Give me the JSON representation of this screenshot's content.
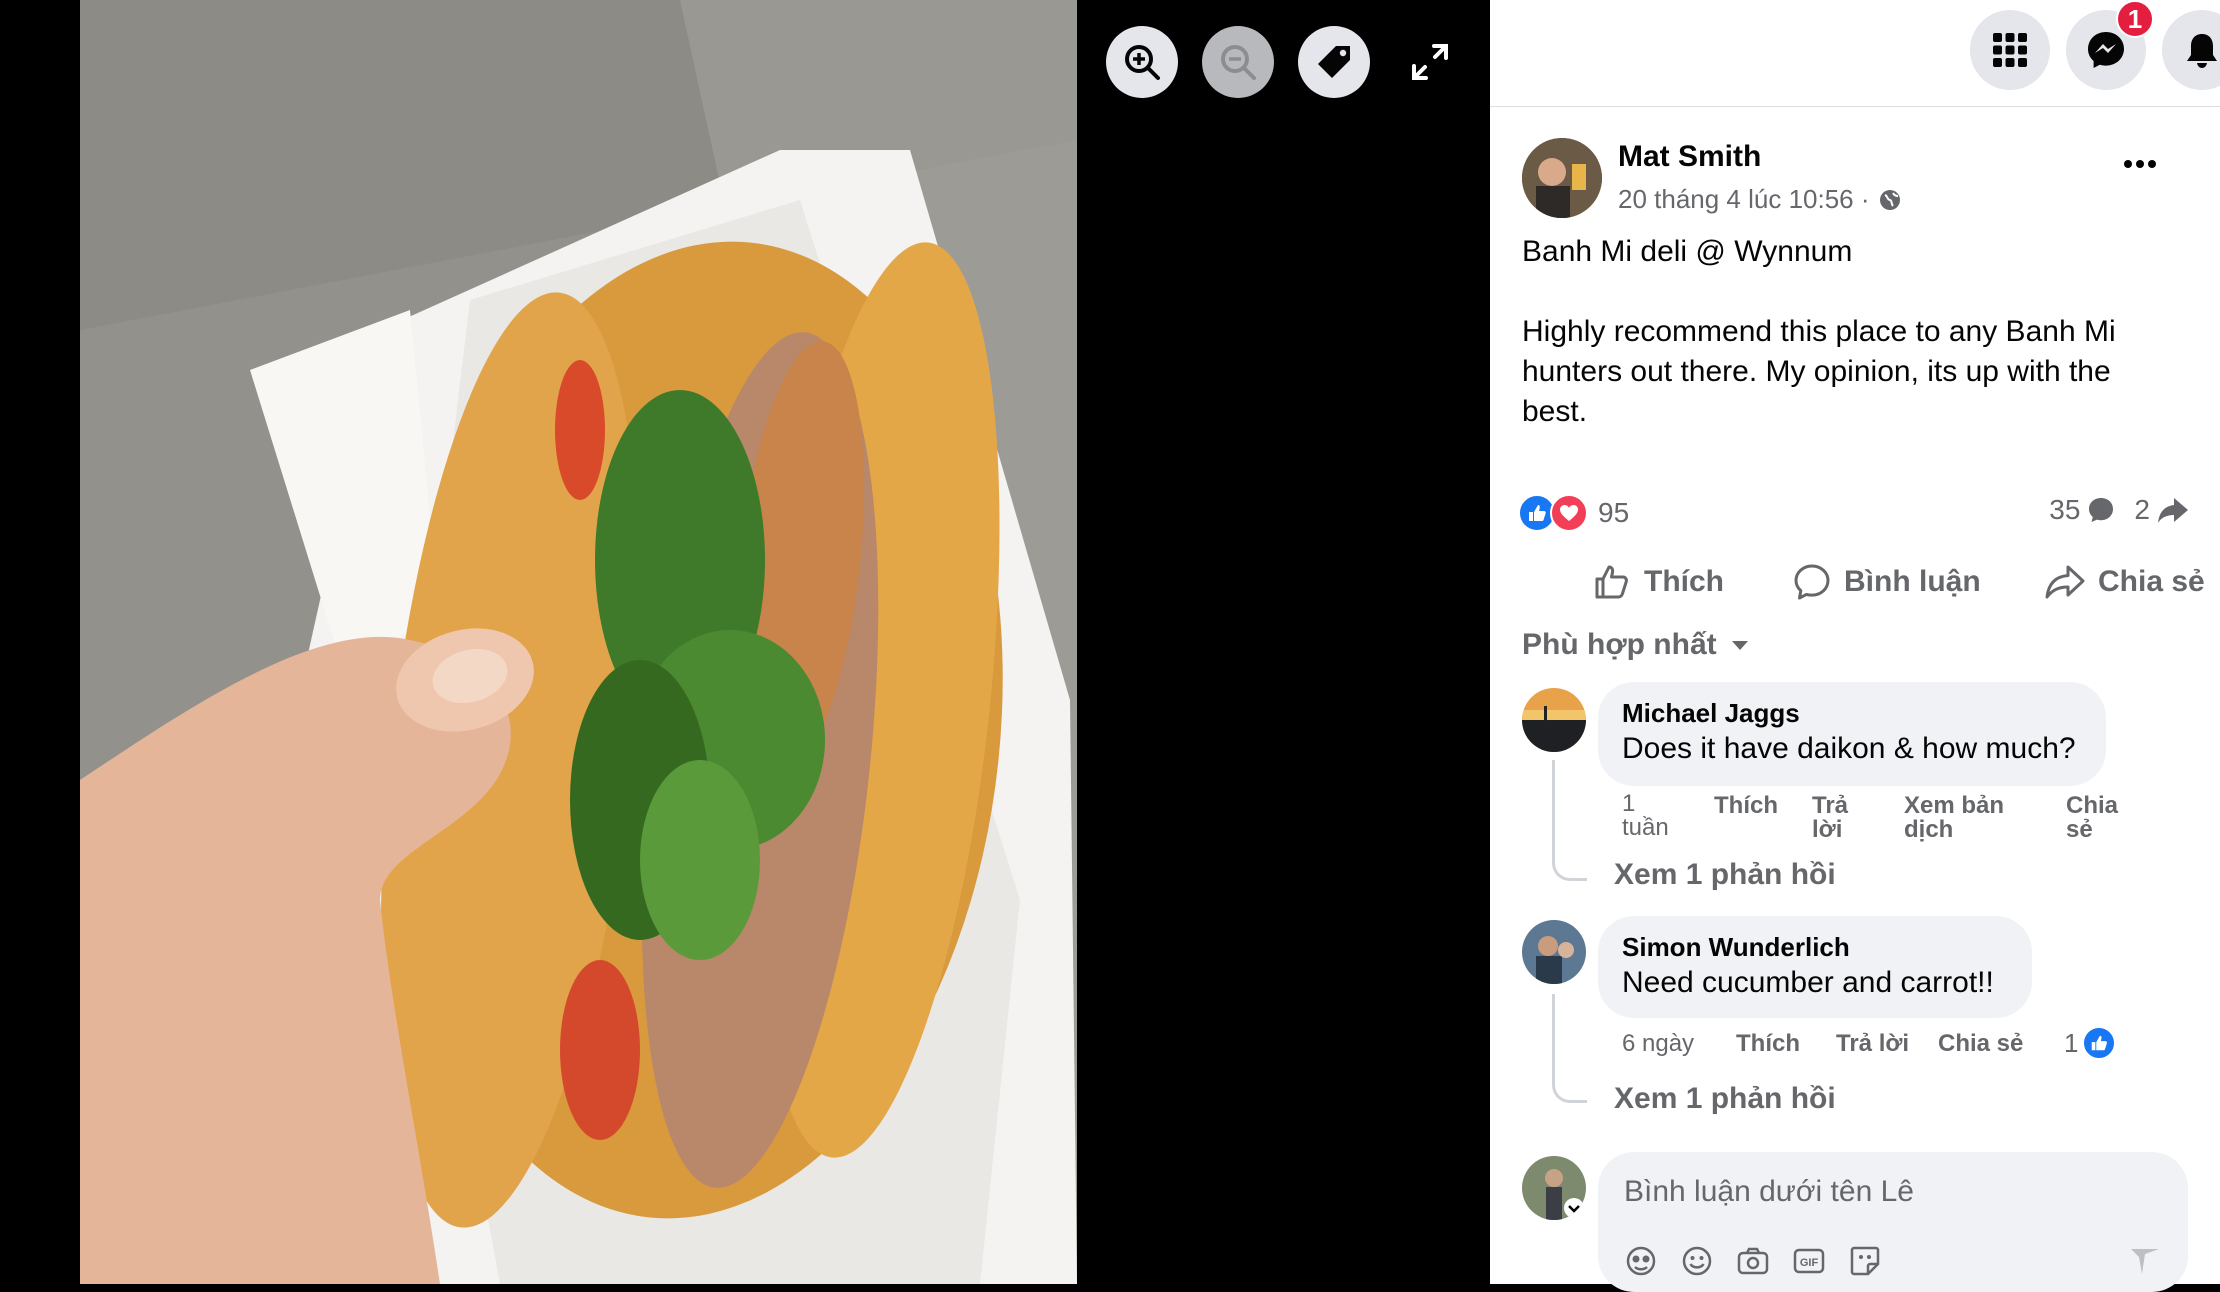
{
  "viewer": {
    "toolbar": [
      {
        "name": "zoom-in-button",
        "icon": "zoom-in-icon"
      },
      {
        "name": "zoom-out-button",
        "icon": "zoom-out-icon"
      },
      {
        "name": "tag-button",
        "icon": "tag-icon"
      },
      {
        "name": "fullscreen-button",
        "icon": "expand-icon"
      }
    ],
    "photo_subject": "banh-mi-sandwich-photo"
  },
  "topbar": {
    "icons": [
      "menu-grid-icon",
      "messenger-icon",
      "bell-icon"
    ],
    "messenger_badge": "1"
  },
  "post": {
    "author": "Mat Smith",
    "time": "20 tháng 4 lúc 10:56 ·",
    "privacy_icon": "globe-icon",
    "text_line1": "Banh Mi deli @ Wynnum",
    "text_body": "Highly recommend this place to any Banh Mi hunters out there. My opinion, its up with the best.",
    "reaction_count": "95",
    "comment_count": "35",
    "share_count": "2",
    "colors": {
      "like_blue": "#1877f2",
      "love_red": "#f33e58",
      "text_secondary": "#65676b"
    }
  },
  "actions": {
    "like": "Thích",
    "comment": "Bình luận",
    "share": "Chia sẻ"
  },
  "sort_label": "Phù hợp nhất",
  "comments": [
    {
      "name": "Michael Jaggs",
      "text": "Does it have daikon & how much?",
      "time_l1": "1",
      "time_l2": "tuần",
      "like": "Thích",
      "reply_l1": "Trả",
      "reply_l2": "lời",
      "translate_l1": "Xem bản",
      "translate_l2": "dịch",
      "share_l1": "Chia",
      "share_l2": "sẻ",
      "view_replies": "Xem 1 phản hồi"
    },
    {
      "name": "Simon Wunderlich",
      "text": "Need cucumber and carrot!!",
      "time": "6 ngày",
      "like": "Thích",
      "reply": "Trả lời",
      "share": "Chia sẻ",
      "like_count": "1",
      "view_replies": "Xem 1 phản hồi"
    }
  ],
  "composer": {
    "placeholder": "Bình luận dưới tên Lê",
    "icons": [
      "avatar-sticker-icon",
      "emoji-icon",
      "camera-icon",
      "gif-icon",
      "sticker-icon",
      "send-icon"
    ]
  }
}
